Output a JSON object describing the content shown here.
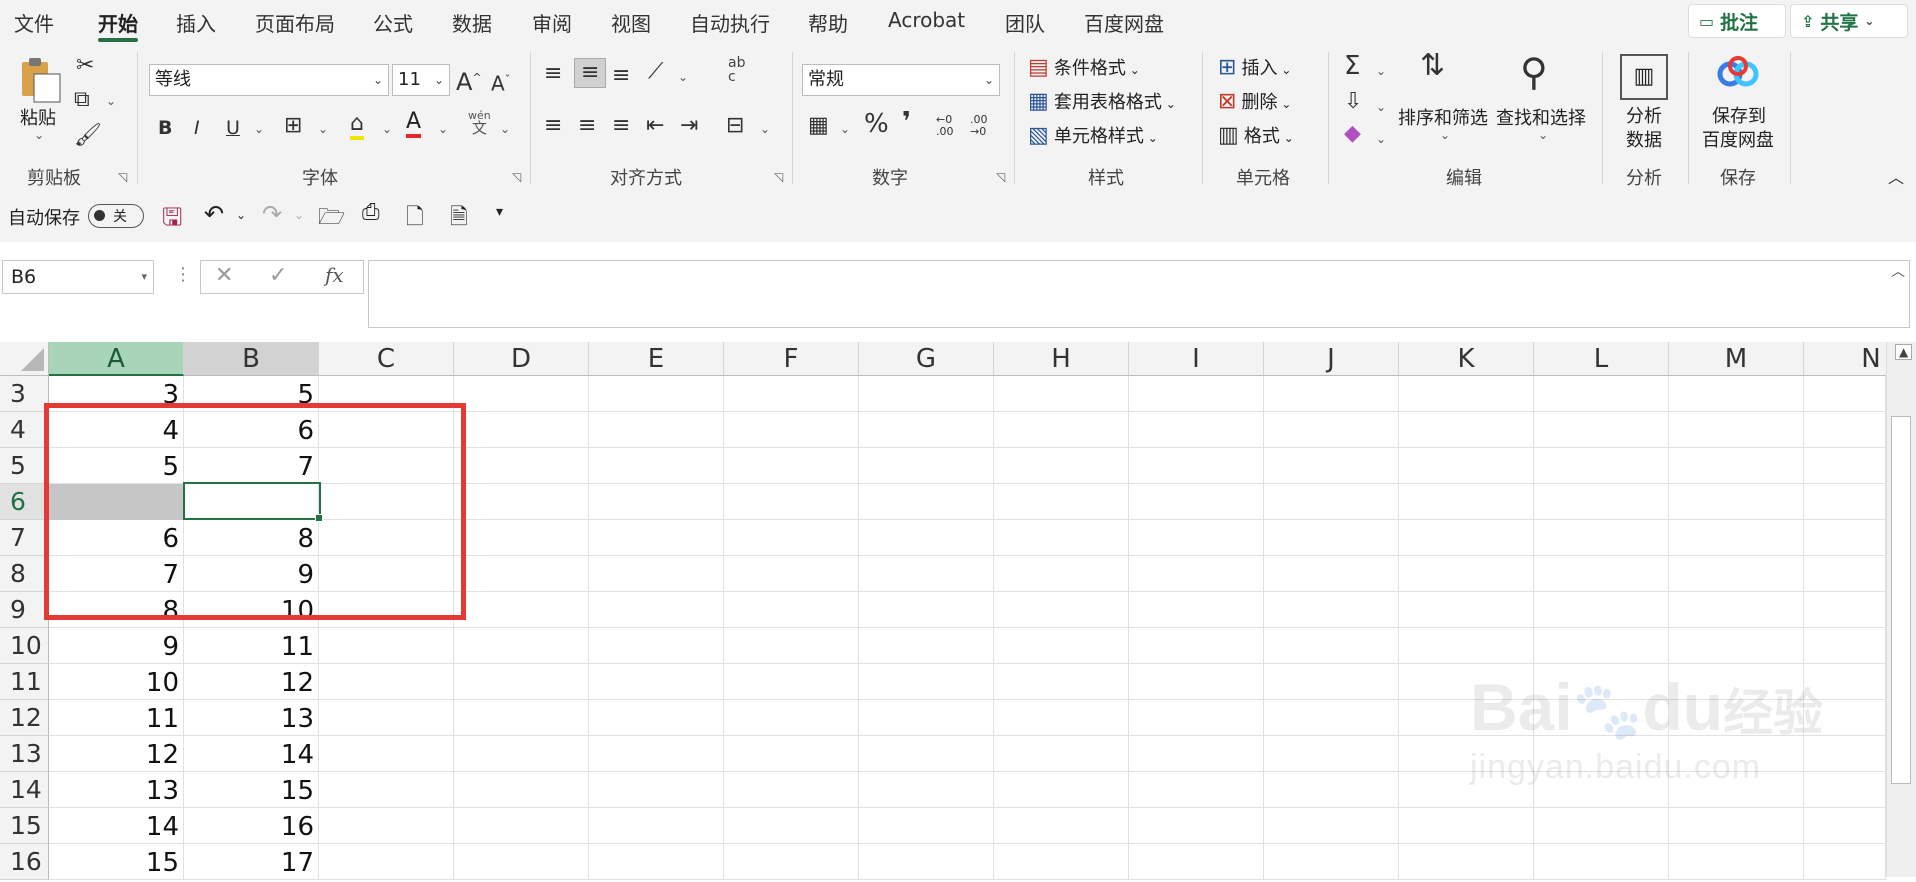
{
  "tabs": [
    "文件",
    "开始",
    "插入",
    "页面布局",
    "公式",
    "数据",
    "审阅",
    "视图",
    "自动执行",
    "帮助",
    "Acrobat",
    "团队",
    "百度网盘"
  ],
  "top_buttons": {
    "comment": "批注",
    "share": "共享"
  },
  "ribbon": {
    "clipboard": {
      "paste": "粘贴",
      "group": "剪贴板"
    },
    "font": {
      "name": "等线",
      "size": "11",
      "group": "字体",
      "grow": "A",
      "shrink": "A",
      "bold": "B",
      "italic": "I",
      "underline": "U",
      "phonetic_top": "wén",
      "phonetic_bottom": "文"
    },
    "alignment": {
      "group": "对齐方式",
      "wrap_top": "ab",
      "wrap_bottom": "c"
    },
    "number": {
      "format": "常规",
      "group": "数字",
      "percent": "%",
      "comma": "❜",
      "inc_dec_top": "←0",
      "inc_dec_bottom": ".00",
      "dec_dec_top": ".00",
      "dec_dec_bottom": "→0"
    },
    "styles": {
      "conditional": "条件格式",
      "table": "套用表格格式",
      "cell": "单元格样式",
      "group": "样式"
    },
    "cells": {
      "insert": "插入",
      "delete": "删除",
      "format": "格式",
      "group": "单元格"
    },
    "editing": {
      "sum": "Σ",
      "sort": "排序和筛选",
      "find": "查找和选择",
      "group": "编辑"
    },
    "analysis": {
      "label_line1": "分析",
      "label_line2": "数据",
      "group": "分析"
    },
    "save": {
      "label_line1": "保存到",
      "label_line2": "百度网盘",
      "group": "保存"
    }
  },
  "qat": {
    "autosave": "自动保存",
    "toggle": "关"
  },
  "formula_bar": {
    "name_box": "B6",
    "fx": "fx",
    "value": ""
  },
  "columns": [
    "A",
    "B",
    "C",
    "D",
    "E",
    "F",
    "G",
    "H",
    "I",
    "J",
    "K",
    "L",
    "M",
    "N"
  ],
  "rows": [
    {
      "num": "3",
      "a": "3",
      "b": "5"
    },
    {
      "num": "4",
      "a": "4",
      "b": "6"
    },
    {
      "num": "5",
      "a": "5",
      "b": "7"
    },
    {
      "num": "6",
      "a": "",
      "b": ""
    },
    {
      "num": "7",
      "a": "6",
      "b": "8"
    },
    {
      "num": "8",
      "a": "7",
      "b": "9"
    },
    {
      "num": "9",
      "a": "8",
      "b": "10"
    },
    {
      "num": "10",
      "a": "9",
      "b": "11"
    },
    {
      "num": "11",
      "a": "10",
      "b": "12"
    },
    {
      "num": "12",
      "a": "11",
      "b": "13"
    },
    {
      "num": "13",
      "a": "12",
      "b": "14"
    },
    {
      "num": "14",
      "a": "13",
      "b": "15"
    },
    {
      "num": "15",
      "a": "14",
      "b": "16"
    },
    {
      "num": "16",
      "a": "15",
      "b": "17"
    }
  ],
  "watermark": {
    "line1": "Bai",
    "line2": "du",
    "line3": "经验",
    "url": "jingyan.baidu.com"
  },
  "colors": {
    "accent": "#217346",
    "highlight": "#e53935"
  }
}
